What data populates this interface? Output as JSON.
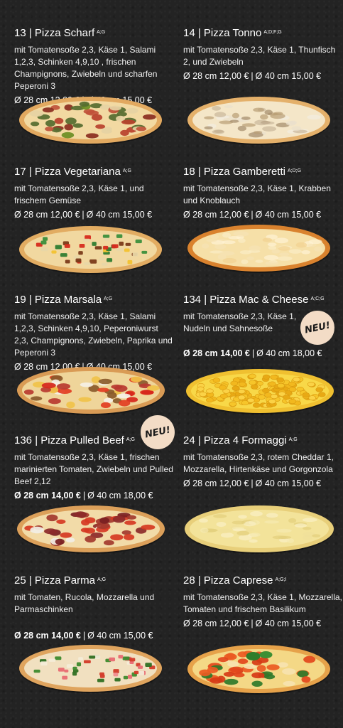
{
  "pizzas": [
    {
      "title": "13 | Pizza Scharf",
      "allergens": "A;G",
      "desc": "mit Tomatensoße 2,3, Käse 1, Salami 1,2,3, Schinken 4,9,10 , frischen Champignons, Zwiebeln und scharfen Peperoni 3",
      "price_small": "Ø 28 cm 12,00 €",
      "price_large": "Ø 40 cm 15,00 €",
      "small_bold": false,
      "topping": "scharf",
      "crust": "#e2a960",
      "cheese": "#f2d9a2"
    },
    {
      "title": "14 | Pizza Tonno",
      "allergens": "A;D;F;G",
      "desc": "mit Tomatensoße 2,3, Käse 1, Thunfisch 2, und Zwiebeln",
      "price_small": "Ø 28 cm 12,00 €",
      "price_large": "Ø 40 cm 15,00 €",
      "small_bold": false,
      "topping": "tonno",
      "crust": "#e4b06a",
      "cheese": "#f4e6c8"
    },
    {
      "title": "17 | Pizza Vegetariana",
      "allergens": "A;G",
      "desc": "mit Tomatensoße 2,3, Käse 1, und frischem Gemüse",
      "price_small": "Ø 28 cm 12,00 €",
      "price_large": "Ø 40 cm 15,00 €",
      "small_bold": false,
      "topping": "veg",
      "crust": "#e2ac62",
      "cheese": "#f1d8a0"
    },
    {
      "title": "18 | Pizza Gamberetti",
      "allergens": "A;D;G",
      "desc": "mit Tomatensoße 2,3, Käse 1, Krabben und Knoblauch",
      "price_small": "Ø 28 cm 12,00 €",
      "price_large": "Ø 40 cm 15,00 €",
      "small_bold": false,
      "topping": "gamb",
      "crust": "#d9822e",
      "cheese": "#f6e0a8"
    },
    {
      "title": "19 | Pizza Marsala",
      "allergens": "A;G",
      "desc": "mit Tomatensoße 2,3, Käse 1, Salami 1,2,3, Schinken 4,9,10, Peperoniwurst 2,3, Champignons, Zwiebeln, Paprika und Peperoni 3",
      "price_small": "Ø 28 cm 12,00 €",
      "price_large": "Ø 40 cm 15,00 €",
      "small_bold": false,
      "topping": "marsala",
      "crust": "#d99b55",
      "cheese": "#efd59a"
    },
    {
      "title": "134 | Pizza Mac & Cheese",
      "allergens": "A;C;G",
      "desc": "mit Tomatensoße 2,3, Käse 1, Nudeln und Sahnesoße",
      "price_small": "Ø 28 cm 14,00 €",
      "price_large": "Ø 40 cm 18,00 €",
      "small_bold": true,
      "badge": "NEU!",
      "topping": "mac",
      "crust": "#f0c030",
      "cheese": "#f8d848"
    },
    {
      "title": "136 | Pizza Pulled Beef",
      "allergens": "A;G",
      "desc": "mit Tomatensoße 2,3, Käse 1, frischen marinierten Tomaten, Zwiebeln und Pulled Beef 2,12",
      "price_small": "Ø 28 cm 14,00 €",
      "price_large": "Ø 40 cm 18,00 €",
      "small_bold": true,
      "badge": "NEU!",
      "topping": "beef",
      "crust": "#dca05a",
      "cheese": "#f2dba8"
    },
    {
      "title": "24 | Pizza 4 Formaggi",
      "allergens": "A;G",
      "desc": "mit Tomatensoße 2,3, rotem Cheddar 1, Mozzarella, Hirtenkäse und Gorgonzola",
      "price_small": "Ø 28 cm 12,00 €",
      "price_large": "Ø 40 cm 15,00 €",
      "small_bold": false,
      "topping": "formaggi",
      "crust": "#e8cf7a",
      "cheese": "#f3e39a"
    },
    {
      "title": "25 | Pizza Parma",
      "allergens": "A;G",
      "desc": "mit Tomaten, Rucola, Mozzarella und Parmaschinken",
      "price_small": "Ø 28 cm 14,00 €",
      "price_large": "Ø 40 cm 15,00 €",
      "small_bold": true,
      "topping": "parma",
      "crust": "#dfa45e",
      "cheese": "#f1e0c0"
    },
    {
      "title": "28 | Pizza Caprese",
      "allergens": "A;G;I",
      "desc": "mit Tomatensoße 2,3, Käse 1, Mozzarella, Tomaten und frischem Basilikum",
      "price_small": "Ø 28 cm 12,00 €",
      "price_large": "Ø 40 cm 15,00 €",
      "small_bold": false,
      "topping": "caprese",
      "crust": "#e6a24a",
      "cheese": "#f4d886"
    }
  ]
}
